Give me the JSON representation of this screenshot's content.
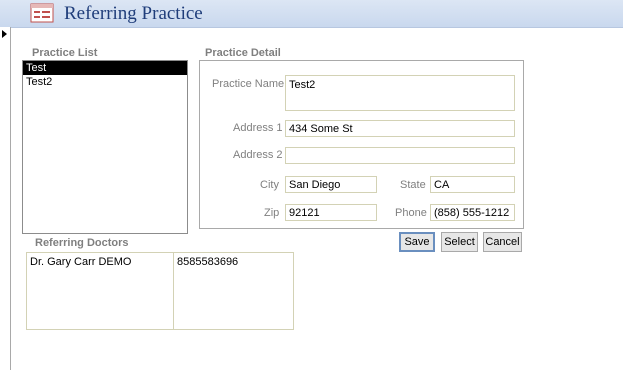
{
  "window": {
    "title": "Referring Practice",
    "title_icon": "form-icon"
  },
  "practice_list": {
    "label": "Practice List",
    "items": [
      {
        "label": "Test",
        "selected": true
      },
      {
        "label": "Test2",
        "selected": false
      }
    ]
  },
  "practice_detail": {
    "label": "Practice Detail",
    "practice_name": {
      "label": "Practice Name",
      "value": "Test2"
    },
    "address1": {
      "label": "Address 1",
      "value": "434 Some St"
    },
    "address2": {
      "label": "Address 2",
      "value": ""
    },
    "city": {
      "label": "City",
      "value": "San Diego"
    },
    "state": {
      "label": "State",
      "value": "CA"
    },
    "zip": {
      "label": "Zip",
      "value": "92121"
    },
    "phone": {
      "label": "Phone",
      "value": "(858) 555-1212"
    }
  },
  "buttons": {
    "save": "Save",
    "select": "Select",
    "cancel": "Cancel"
  },
  "referring_doctors": {
    "label": "Referring Doctors",
    "rows": [
      {
        "name": "Dr. Gary Carr DEMO",
        "phone": "8585583696"
      }
    ]
  }
}
